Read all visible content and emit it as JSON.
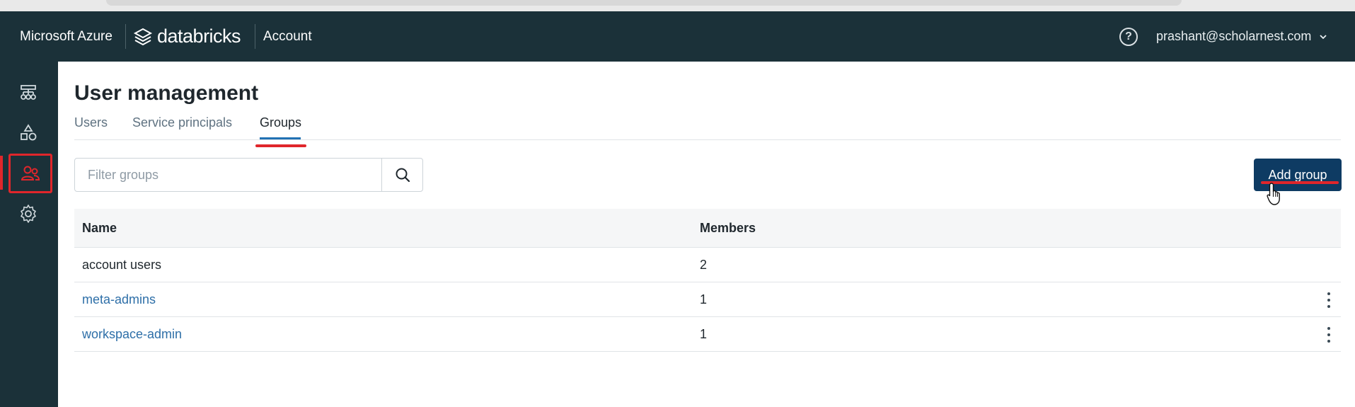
{
  "topbar": {
    "brand": "Microsoft Azure",
    "product": "databricks",
    "section": "Account",
    "user_email": "prashant@scholarnest.com",
    "help_glyph": "?"
  },
  "sidebar": {
    "items": [
      {
        "name": "workspaces-icon"
      },
      {
        "name": "catalog-icon"
      },
      {
        "name": "user-management-icon",
        "active": true
      },
      {
        "name": "settings-icon"
      }
    ]
  },
  "page": {
    "title": "User management",
    "tabs": [
      "Users",
      "Service principals",
      "Groups"
    ],
    "active_tab": "Groups"
  },
  "filter": {
    "placeholder": "Filter groups",
    "value": ""
  },
  "actions": {
    "add_group_label": "Add group"
  },
  "table": {
    "columns": [
      "Name",
      "Members"
    ],
    "rows": [
      {
        "name": "account users",
        "members": "2",
        "link": false
      },
      {
        "name": "meta-admins",
        "members": "1",
        "link": true
      },
      {
        "name": "workspace-admin",
        "members": "1",
        "link": true
      }
    ]
  },
  "colors": {
    "topbar_bg": "#1b3139",
    "primary_button": "#0e3b63",
    "link": "#2e6fa8",
    "annotation_red": "#e0262b",
    "tab_underline": "#2272b4"
  }
}
